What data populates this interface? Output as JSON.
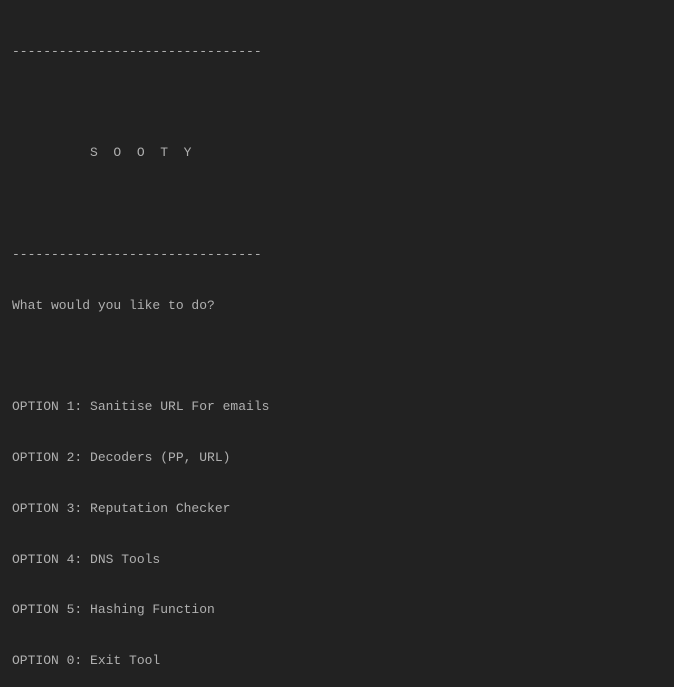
{
  "banner": {
    "line_top": "--------------------------------",
    "title": "          S  O  O  T  Y",
    "line_bottom": "--------------------------------"
  },
  "prompt": "What would you like to do?",
  "options": {
    "opt1": "OPTION 1: Sanitise URL For emails",
    "opt2": "OPTION 2: Decoders (PP, URL)",
    "opt3": "OPTION 3: Reputation Checker",
    "opt4": "OPTION 4: DNS Tools",
    "opt5": "OPTION 5: Hashing Function",
    "opt0": "OPTION 0: Exit Tool"
  }
}
